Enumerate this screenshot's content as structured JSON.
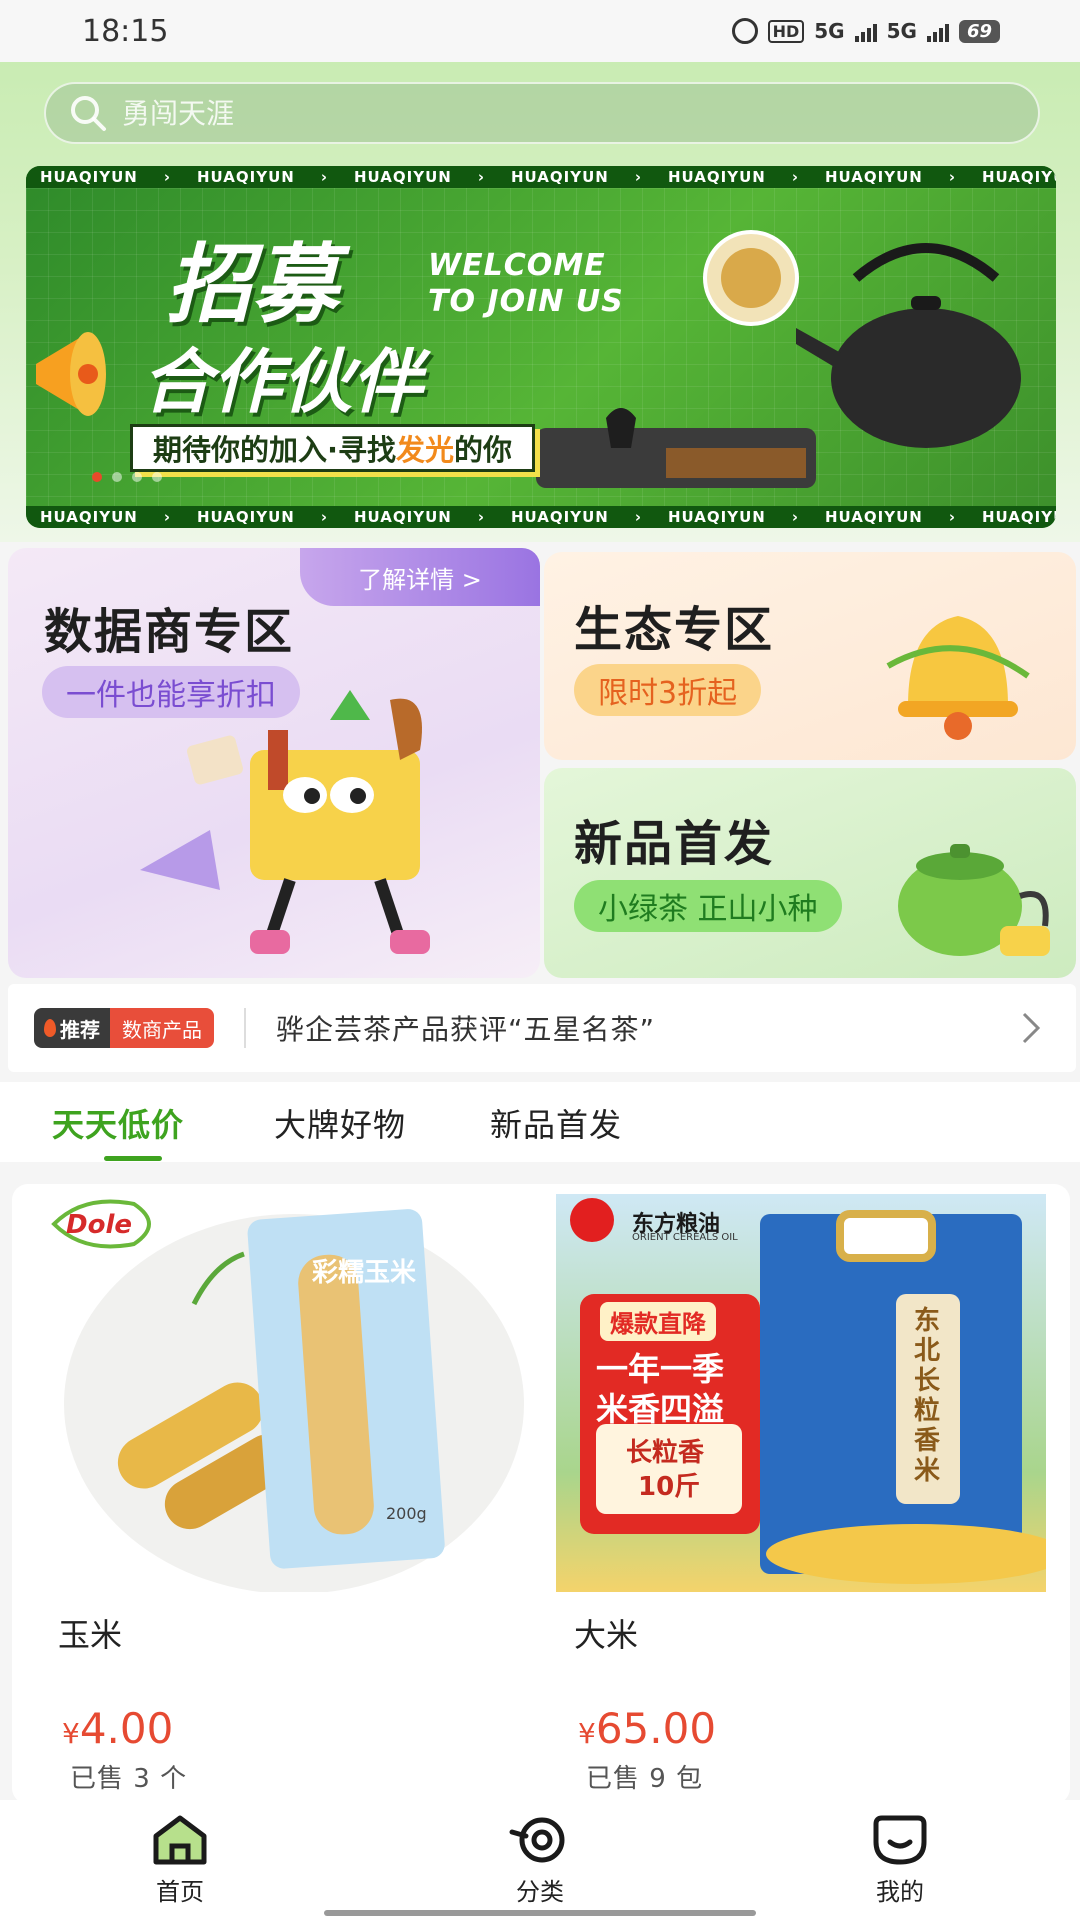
{
  "status_bar": {
    "time": "18:15",
    "hd": "HD",
    "net1": "5G",
    "net2": "5G",
    "battery": "69"
  },
  "search": {
    "placeholder": "勇闯天涯"
  },
  "banner": {
    "strip_text": "HUAQIYUN",
    "title_line1": "招募",
    "title_line2": "合作伙伴",
    "welcome_line1": "WELCOME",
    "welcome_line2": "TO JOIN US",
    "subtitle_a": "期待你的加入·寻找",
    "subtitle_b": "发光",
    "subtitle_c": "的你"
  },
  "zones": {
    "data_merchant": {
      "title": "数据商专区",
      "pill": "一件也能享折扣",
      "tag": "了解详情 >"
    },
    "ecology": {
      "title": "生态专区",
      "pill": "限时3折起"
    },
    "new_release": {
      "title": "新品首发",
      "pill": "小绿茶 正山小种"
    }
  },
  "notice": {
    "badge_a": "推荐",
    "badge_b": "数商产品",
    "text": "骅企芸茶产品获评“五星名茶”"
  },
  "tabs": [
    {
      "label": "天天低价",
      "active": true
    },
    {
      "label": "大牌好物",
      "active": false
    },
    {
      "label": "新品首发",
      "active": false
    }
  ],
  "products": [
    {
      "name": "玉米",
      "currency": "¥",
      "price": "4.00",
      "sold": "已售 3 个",
      "brand": "Dole",
      "pack_text": "彩糯玉米",
      "weight": "200g"
    },
    {
      "name": "大米",
      "currency": "¥",
      "price": "65.00",
      "sold": "已售 9 包",
      "brand": "东方粮油",
      "brand_en": "ORIENT CEREALS OIL",
      "badge": "爆款直降",
      "slogan1": "一年一季",
      "slogan2": "米香四溢",
      "tag1": "长粒香",
      "tag2": "10斤",
      "bag_text": "东北长粒香米"
    }
  ],
  "bottom_nav": [
    {
      "label": "首页",
      "icon": "home-icon"
    },
    {
      "label": "分类",
      "icon": "category-icon"
    },
    {
      "label": "我的",
      "icon": "profile-icon"
    }
  ],
  "colors": {
    "accent_green": "#3ea31f",
    "price_red": "#e64a32"
  }
}
